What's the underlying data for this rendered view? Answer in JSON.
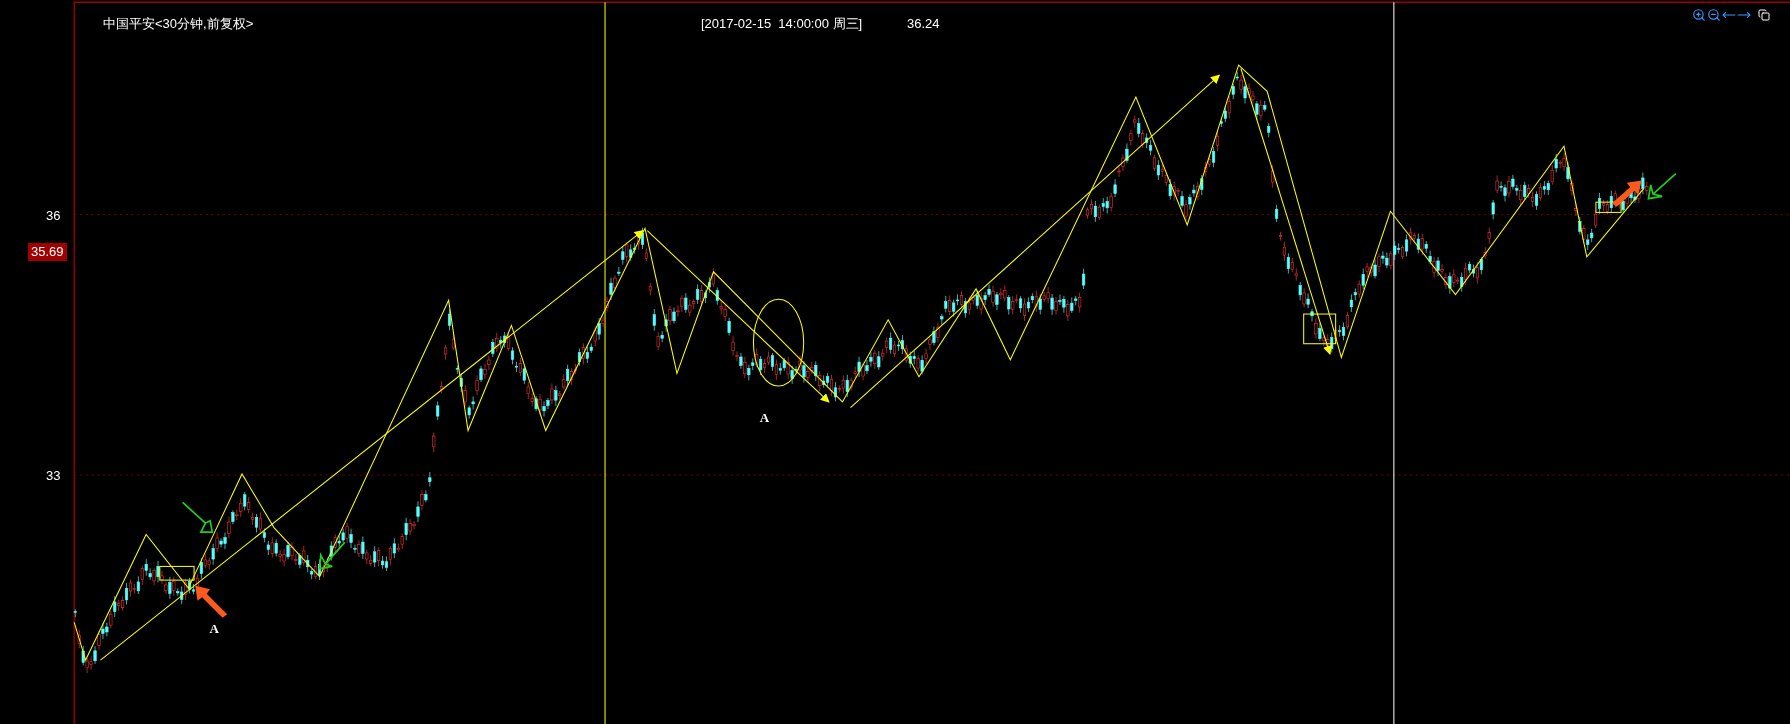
{
  "chart": {
    "title": "中国平安<30分钟,前复权>",
    "cursor_time": "[2017-02-15  14:00:00 周三]",
    "cursor_price": "36.24",
    "price_axis": [
      "36",
      "33"
    ],
    "current_price": "35.69",
    "annotations": [
      "A",
      "A"
    ]
  }
}
